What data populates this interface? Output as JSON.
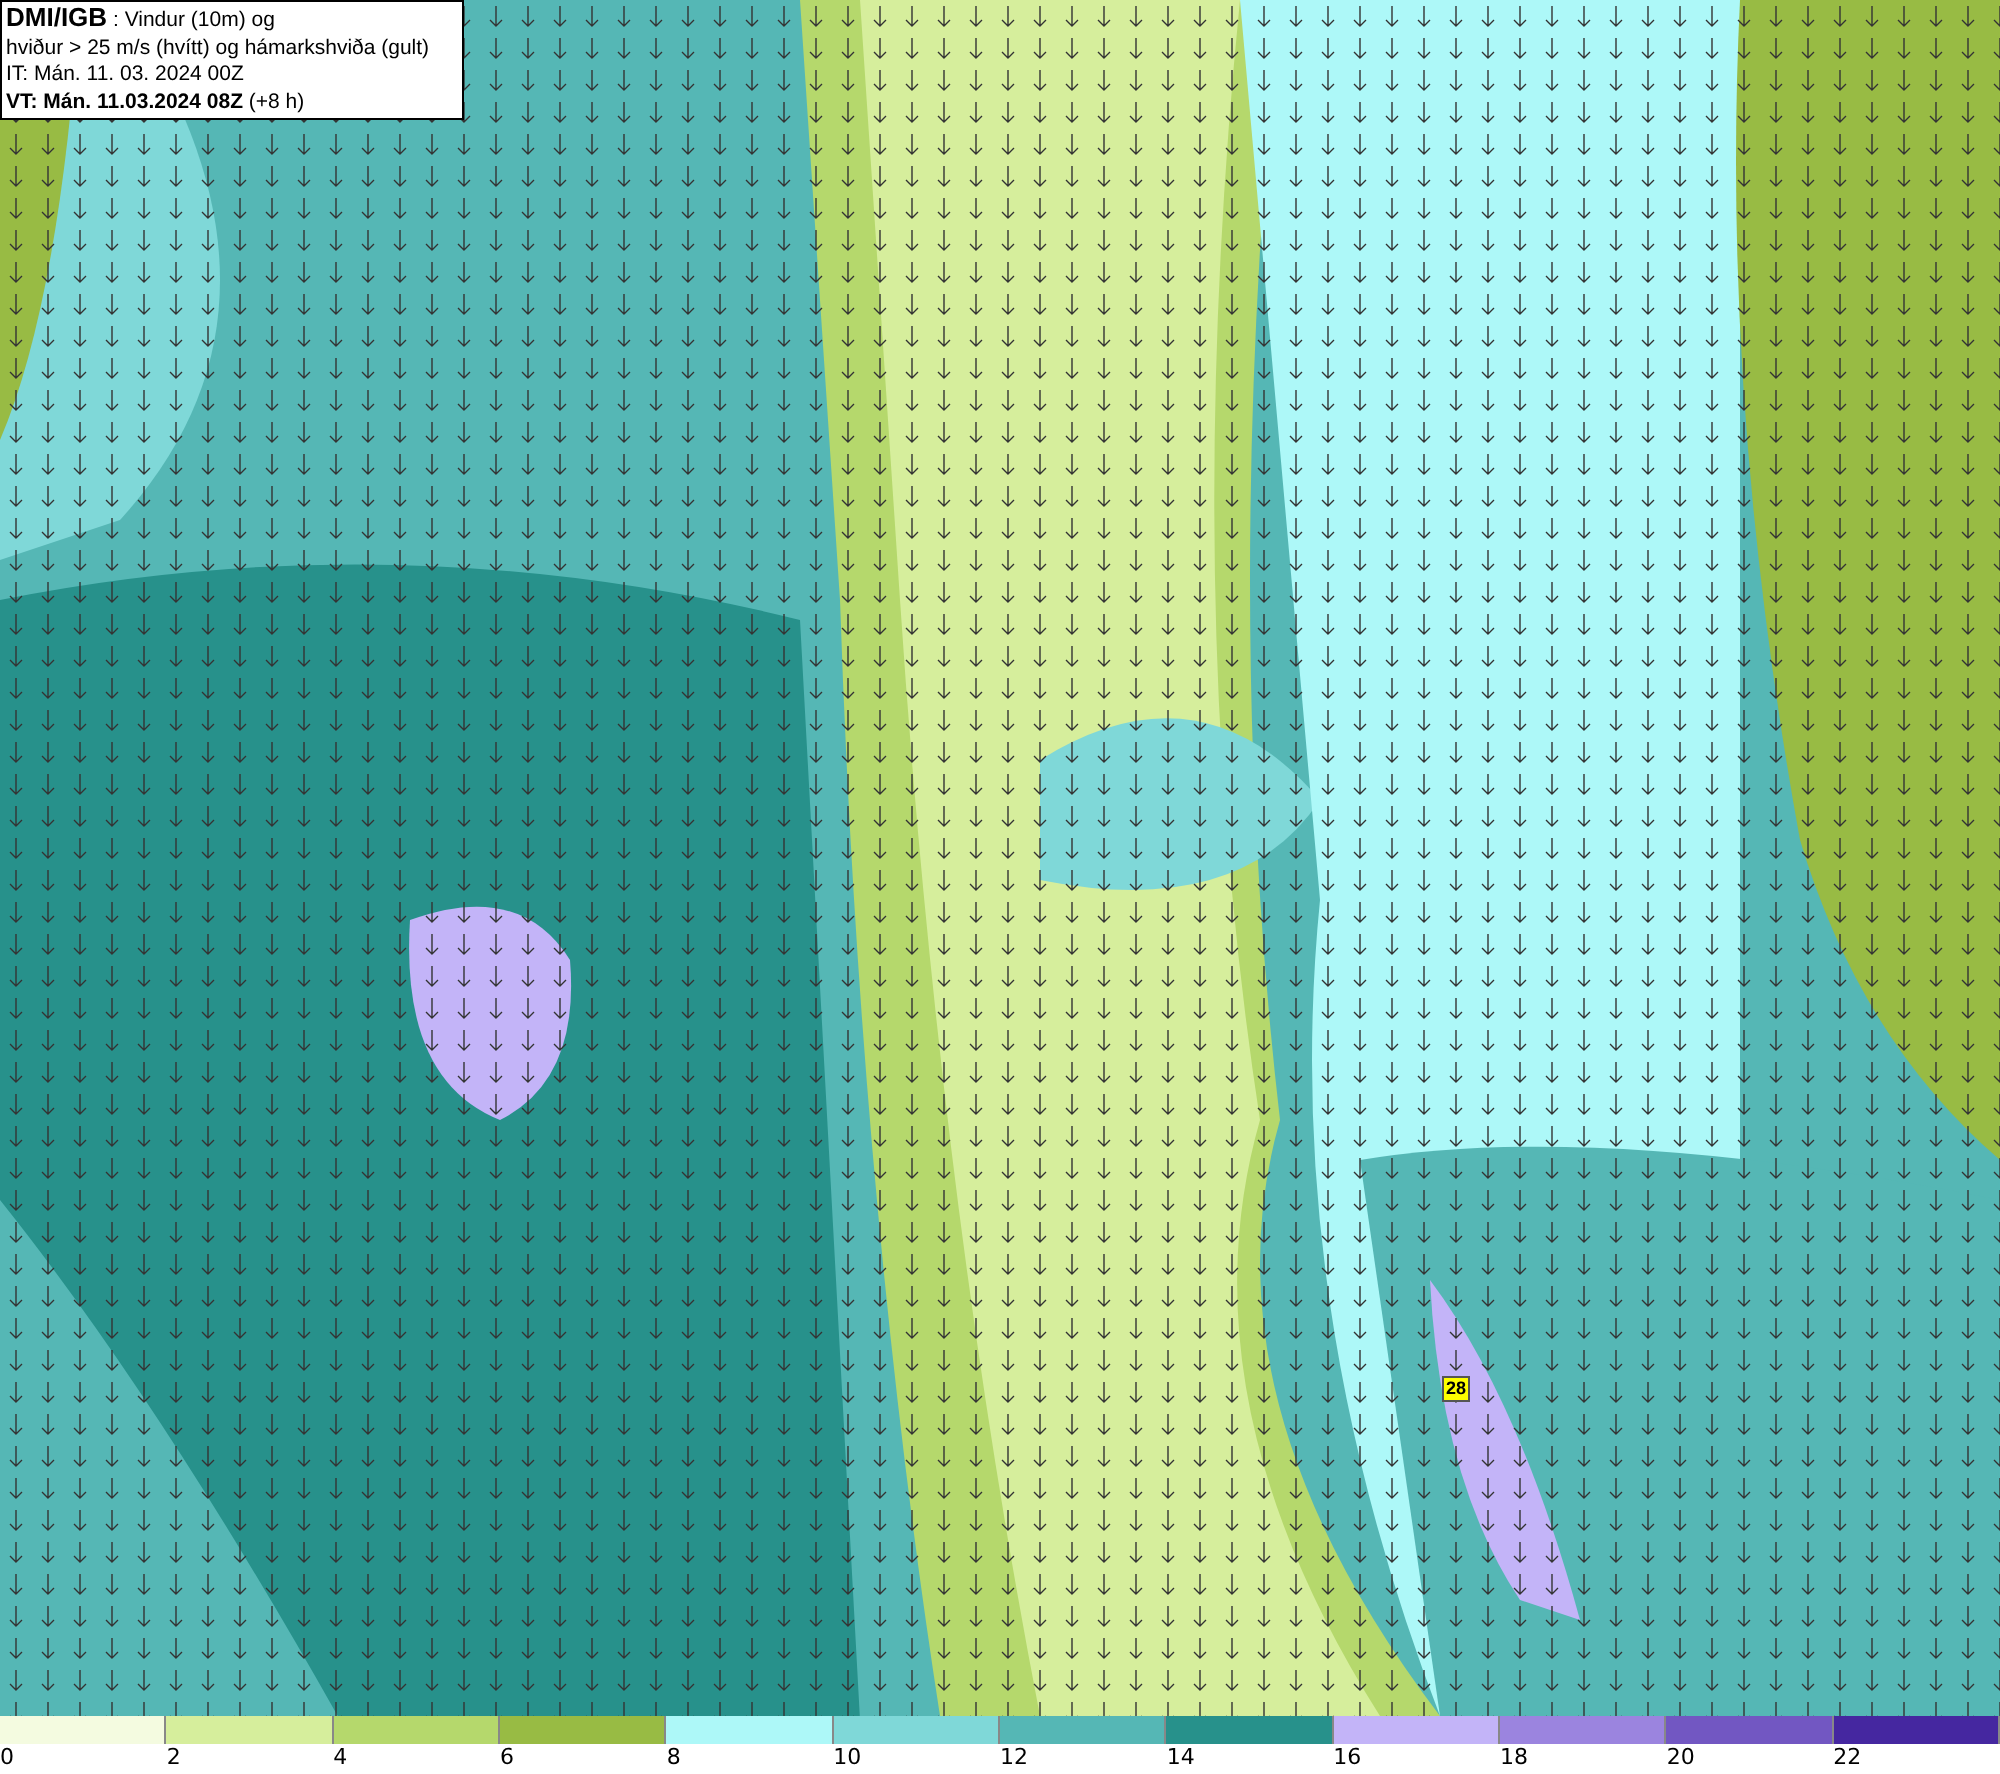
{
  "header": {
    "source": "DMI/IGB",
    "title": " : Vindur (10m) og",
    "subtitle": "hviður > 25 m/s (hvítt) og hámarkshviða (gult)",
    "issue_time": "IT: Mán. 11. 03. 2024 00Z",
    "valid_time": "VT: Mán. 11.03.2024 08Z",
    "lead": " (+8 h)"
  },
  "gust_marker": {
    "label": "28"
  },
  "legend": [
    {
      "label": "0",
      "color": "#f4fbe0"
    },
    {
      "label": "2",
      "color": "#d6ee9c"
    },
    {
      "label": "4",
      "color": "#b5d86c"
    },
    {
      "label": "6",
      "color": "#98bb44"
    },
    {
      "label": "8",
      "color": "#adf8f8"
    },
    {
      "label": "10",
      "color": "#7fd8d8"
    },
    {
      "label": "12",
      "color": "#55b7b5"
    },
    {
      "label": "14",
      "color": "#27918b"
    },
    {
      "label": "16",
      "color": "#c3b4f8"
    },
    {
      "label": "18",
      "color": "#9b84df"
    },
    {
      "label": "20",
      "color": "#7257c2"
    },
    {
      "label": "22",
      "color": "#4527a0"
    }
  ]
}
